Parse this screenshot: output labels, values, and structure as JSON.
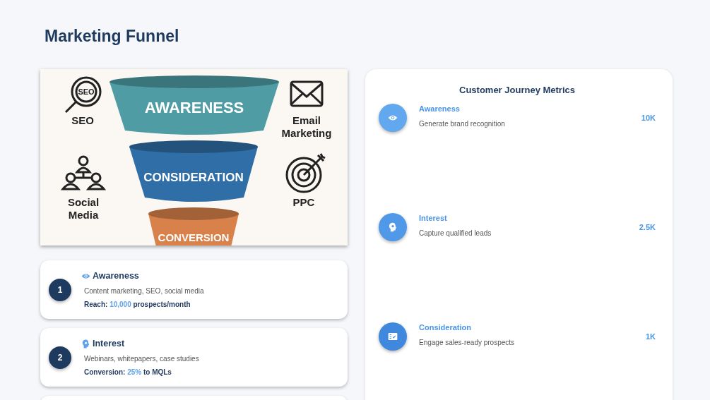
{
  "page_title": "Marketing Funnel",
  "funnel": {
    "stages": [
      {
        "label": "AWARENESS",
        "color": "#4f9ca5"
      },
      {
        "label": "CONSIDERATION",
        "color": "#2f6ea6"
      },
      {
        "label": "CONVERSION",
        "color": "#d9814a"
      }
    ],
    "channels": [
      {
        "kind": "seo",
        "icon_text": "SEO",
        "lines": [
          "SEO"
        ]
      },
      {
        "kind": "email",
        "lines": [
          "Email",
          "Marketing"
        ]
      },
      {
        "kind": "social",
        "lines": [
          "Social",
          "Media"
        ]
      },
      {
        "kind": "target",
        "lines": [
          "PPC"
        ]
      }
    ]
  },
  "stages": [
    {
      "number": "1",
      "kind": "eye",
      "title": "Awareness",
      "description": "Content marketing, SEO, social media",
      "stat": {
        "label": "Reach:",
        "value": "10,000",
        "suffix": "prospects/month"
      }
    },
    {
      "number": "2",
      "kind": "head",
      "title": "Interest",
      "description": "Webinars, whitepapers, case studies",
      "stat": {
        "label": "Conversion:",
        "value": "25%",
        "suffix": "to MQLs"
      }
    }
  ],
  "metrics": {
    "title": "Customer Journey Metrics",
    "items": [
      {
        "kind": "eye",
        "title": "Awareness",
        "description": "Generate brand recognition",
        "value": "10K",
        "color": "#62a8ee"
      },
      {
        "kind": "head",
        "title": "Interest",
        "description": "Capture qualified leads",
        "value": "2.5K",
        "color": "#5098e8"
      },
      {
        "kind": "checklist",
        "title": "Consideration",
        "description": "Engage sales-ready prospects",
        "value": "1K",
        "color": "#3f88dd"
      }
    ]
  }
}
